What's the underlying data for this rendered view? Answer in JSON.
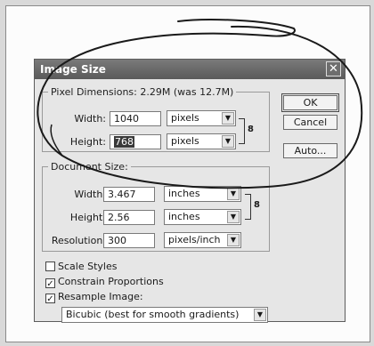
{
  "dialog": {
    "title": "Image Size",
    "close_glyph": "✕",
    "pixel_dimensions": {
      "legend": "Pixel Dimensions: 2.29M (was 12.7M)",
      "width_label": "Width:",
      "width_value": "1040",
      "width_unit": "pixels",
      "height_label": "Height:",
      "height_value": "768",
      "height_unit": "pixels"
    },
    "document_size": {
      "legend": "Document Size:",
      "width_label": "Width:",
      "width_value": "3.467",
      "width_unit": "inches",
      "height_label": "Height:",
      "height_value": "2.56",
      "height_unit": "inches",
      "resolution_label": "Resolution:",
      "resolution_value": "300",
      "resolution_unit": "pixels/inch"
    },
    "buttons": {
      "ok": "OK",
      "cancel": "Cancel",
      "auto": "Auto..."
    },
    "checkboxes": {
      "scale_styles": {
        "label": "Scale Styles",
        "checked": false
      },
      "constrain_proportions": {
        "label": "Constrain Proportions",
        "checked": true
      },
      "resample_image": {
        "label": "Resample Image:",
        "checked": true
      }
    },
    "resample_method": "Bicubic (best for smooth gradients)",
    "check_glyph": "✓",
    "arrow_glyph": "▼",
    "chain_glyph": "8"
  }
}
